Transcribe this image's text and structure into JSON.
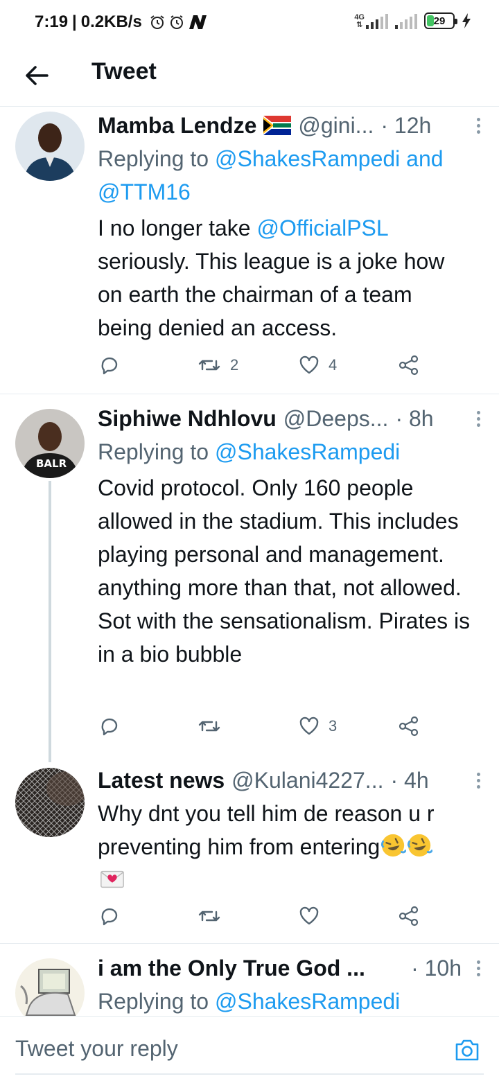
{
  "status_bar": {
    "time": "7:19",
    "speed": "0.2KB/s",
    "network": "4G",
    "battery": "29",
    "battery_level": 0.29
  },
  "header": {
    "title": "Tweet",
    "back_icon": "arrow-left-icon"
  },
  "tweets": [
    {
      "name": "Mamba Lendze",
      "handle": "@gini...",
      "time": "· 12h",
      "reply_prefix": "Replying to ",
      "reply_user1": "@ShakesRampedi",
      "reply_and": " and",
      "reply_user2": "@TTM16",
      "body_line1_prefix": "I no longer take ",
      "body_line1_mention": "@OfficialPSL",
      "body_rest": "seriously.  This league is a joke how on earth the chairman of a team being denied an access.",
      "retweets": "2",
      "likes": "4"
    },
    {
      "name": "Siphiwe Ndhlovu",
      "handle": "@Deeps...",
      "time": "· 8h",
      "reply_prefix": "Replying to ",
      "reply_user1": "@ShakesRampedi",
      "body": "Covid protocol. Only 160 people allowed in the stadium. This includes playing personal and management. anything more than that, not allowed. Sot with the sensationalism. Pirates is in a bio bubble",
      "avatar_text": "BALR",
      "retweets": "",
      "likes": "3"
    },
    {
      "name": "Latest news",
      "handle": "@Kulani4227...",
      "time": "· 4h",
      "body_line1": "Why dnt you tell him de reason u r",
      "body_line2": "preventing him from entering",
      "retweets": "",
      "likes": ""
    },
    {
      "name": "i am the Only True God ...",
      "time": "· 10h",
      "reply_prefix": "Replying to ",
      "reply_user1": "@ShakesRampedi"
    }
  ],
  "reply_bar": {
    "placeholder": "Tweet your reply",
    "camera_icon": "camera-icon"
  },
  "colors": {
    "accent": "#1d9bf0",
    "text": "#0f1419",
    "muted": "#536471",
    "divider": "#e6ecf0"
  }
}
